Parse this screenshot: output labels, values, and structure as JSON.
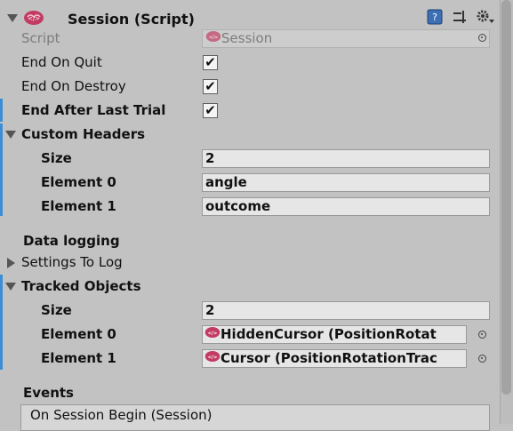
{
  "header": {
    "title": "Session (Script)",
    "help_icon": "help-book-icon",
    "preset_icon": "preset-sliders-icon",
    "settings_icon": "gear-dropdown-icon",
    "script_icon": "brain-script-icon"
  },
  "script": {
    "label": "Script",
    "value": "Session"
  },
  "end_on_quit": {
    "label": "End On Quit",
    "checked": "✔"
  },
  "end_on_destroy": {
    "label": "End On Destroy",
    "checked": "✔"
  },
  "end_after_last_trial": {
    "label": "End After Last Trial",
    "checked": "✔"
  },
  "custom_headers": {
    "label": "Custom Headers",
    "size_label": "Size",
    "size_value": "2",
    "elements": [
      {
        "label": "Element 0",
        "value": "angle"
      },
      {
        "label": "Element 1",
        "value": "outcome"
      }
    ]
  },
  "data_logging": {
    "label": "Data logging",
    "settings_to_log": "Settings To Log"
  },
  "tracked_objects": {
    "label": "Tracked Objects",
    "size_label": "Size",
    "size_value": "2",
    "elements": [
      {
        "label": "Element 0",
        "value": "HiddenCursor (PositionRotat"
      },
      {
        "label": "Element 1",
        "value": "Cursor (PositionRotationTrac"
      }
    ]
  },
  "events": {
    "label": "Events",
    "on_session_begin": "On Session Begin (Session)"
  },
  "colors": {
    "background": "#c2c2c2",
    "accent": "#3b8ed3",
    "script_icon": "#c23b63"
  }
}
